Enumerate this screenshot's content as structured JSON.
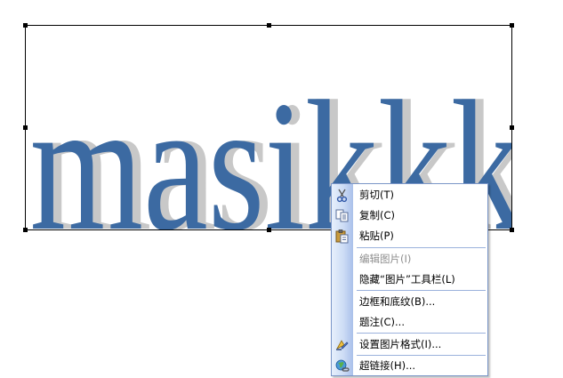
{
  "picture": {
    "text": "masikk k",
    "word": "masikkk",
    "text_color": "#3c6aa2",
    "shadow_color": "#c8c8c8"
  },
  "context_menu": {
    "items": [
      {
        "label": "剪切(T)",
        "icon": "scissors-icon",
        "enabled": true
      },
      {
        "label": "复制(C)",
        "icon": "copy-icon",
        "enabled": true
      },
      {
        "label": "粘贴(P)",
        "icon": "paste-icon",
        "enabled": true
      },
      {
        "label": "编辑图片(I)",
        "icon": "",
        "enabled": false
      },
      {
        "label": "隐藏“图片”工具栏(L)",
        "icon": "",
        "enabled": true
      },
      {
        "label": "边框和底纹(B)...",
        "icon": "",
        "enabled": true
      },
      {
        "label": "题注(C)...",
        "icon": "",
        "enabled": true
      },
      {
        "label": "设置图片格式(I)...",
        "icon": "format-picture-icon",
        "enabled": true
      },
      {
        "label": "超链接(H)...",
        "icon": "hyperlink-globe-icon",
        "enabled": true
      }
    ],
    "colors": {
      "gutter": "#cddcf5",
      "border": "#7a96c8",
      "disabled_text": "#8e8e8e"
    }
  }
}
